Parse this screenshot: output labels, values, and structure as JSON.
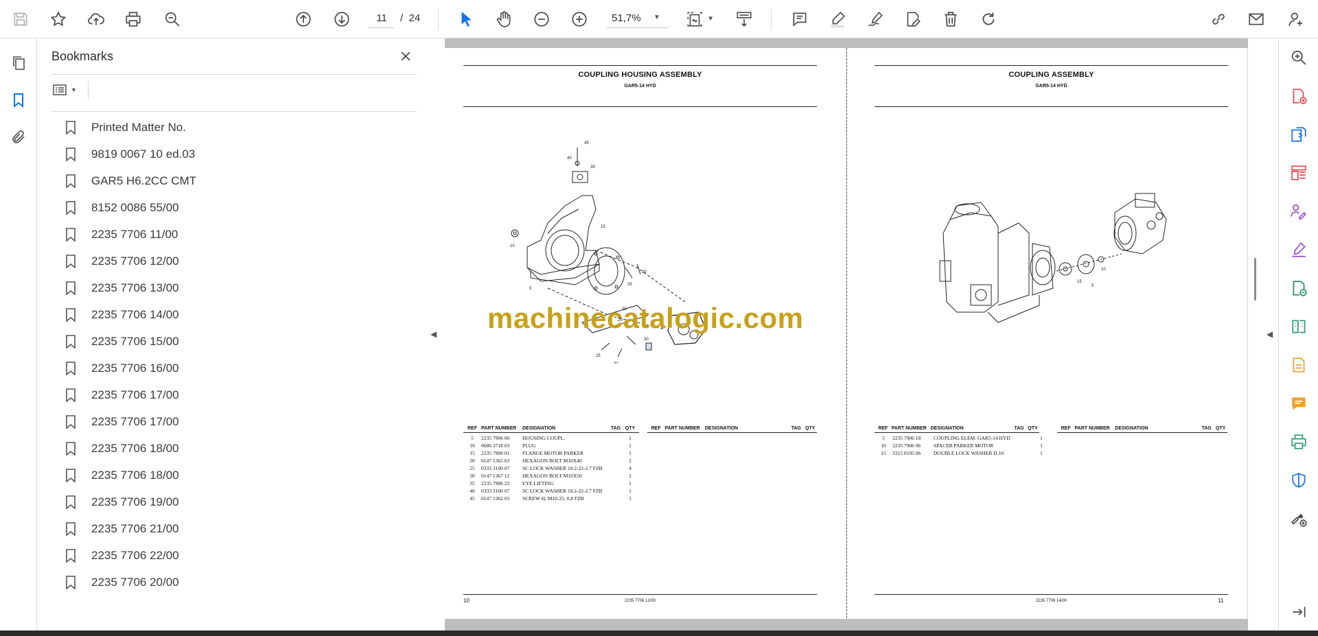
{
  "toolbar": {
    "page_current": "11",
    "page_separator": "/",
    "page_total": "24",
    "zoom": "51,7%"
  },
  "bookmarks": {
    "title": "Bookmarks",
    "items": [
      "Printed Matter No.",
      "9819 0067 10 ed.03",
      "GAR5 H6.2CC CMT",
      "8152 0086 55/00",
      "2235 7706 11/00",
      "2235 7706 12/00",
      "2235 7706 13/00",
      "2235 7706 14/00",
      "2235 7706 15/00",
      "2235 7706 16/00",
      "2235 7706 17/00",
      "2235 7706 17/00",
      "2235 7706 18/00",
      "2235 7706 18/00",
      "2235 7706 19/00",
      "2235 7706 21/00",
      "2235 7706 22/00",
      "2235 7706 20/00"
    ]
  },
  "left_page": {
    "title": "COUPLING HOUSING ASSEMBLY",
    "subtitle": "GAR5-14 HYD",
    "headers": [
      "REF",
      "PART NUMBER",
      "DESIGNATION",
      "TAG",
      "QTY"
    ],
    "rows": [
      [
        "5",
        "2235 7906 00",
        "HOUSING COUPL.",
        "",
        "1"
      ],
      [
        "10",
        "0686 3718 03",
        "PLUG",
        "",
        "1"
      ],
      [
        "15",
        "2235 7906 01",
        "FLANGE MOTOR PARKER",
        "",
        "1"
      ],
      [
        "20",
        "0147 1365 03",
        "HEXAGON BOLT M10X40",
        "",
        "2"
      ],
      [
        "25",
        "0333 3100 07",
        "SC LOCK WASHER 10.2-22-2.7 FZB",
        "",
        "4"
      ],
      [
        "30",
        "0147 1367 12",
        "HEXAGON BOLT M10X50",
        "",
        "2"
      ],
      [
        "35",
        "2235 7906 22",
        "EYE LIFTING",
        "",
        "1"
      ],
      [
        "40",
        "0333 3100 07",
        "SC LOCK WASHER 10.2-22-2.7 FZB",
        "",
        "1"
      ],
      [
        "45",
        "0147 1362 03",
        "SCREW H, M10-25, 8,8 FZB",
        "",
        "1"
      ]
    ],
    "footer_left": "10",
    "footer_center": "2235 7706 12/00",
    "callouts": [
      "45",
      "40",
      "35",
      "10",
      "15",
      "20",
      "25",
      "5",
      "20",
      "25",
      "30",
      "25",
      "30"
    ]
  },
  "right_page": {
    "title": "COUPLING ASSEMBLY",
    "subtitle": "GAR5-14 HYD",
    "headers": [
      "REF",
      "PART NUMBER",
      "DESIGNATION",
      "TAG",
      "QTY"
    ],
    "rows": [
      [
        "5",
        "2235 7906 18",
        "COUPLING ELEM. GAR5-14 HYD",
        "",
        "1"
      ],
      [
        "10",
        "2235 7906 06",
        "SPACER PARKER MOTOR",
        "",
        "1"
      ],
      [
        "15",
        "3315 0195 06",
        "DOUBLE LOCK WASHER D.10",
        "",
        "1"
      ]
    ],
    "footer_center": "2235 7706 14/00",
    "footer_right": "11",
    "callouts": [
      "15",
      "10",
      "5"
    ]
  },
  "watermark": "machinecatalogic.com",
  "colors": {
    "accent": "#1473e6",
    "watermark": "#c8a11a",
    "rail_red": "#e34850",
    "rail_blue": "#1473e6",
    "rail_purple": "#9b4dca",
    "rail_yellow": "#e8a33a",
    "rail_green": "#2d9d78",
    "rail_teal": "#268e6c"
  }
}
